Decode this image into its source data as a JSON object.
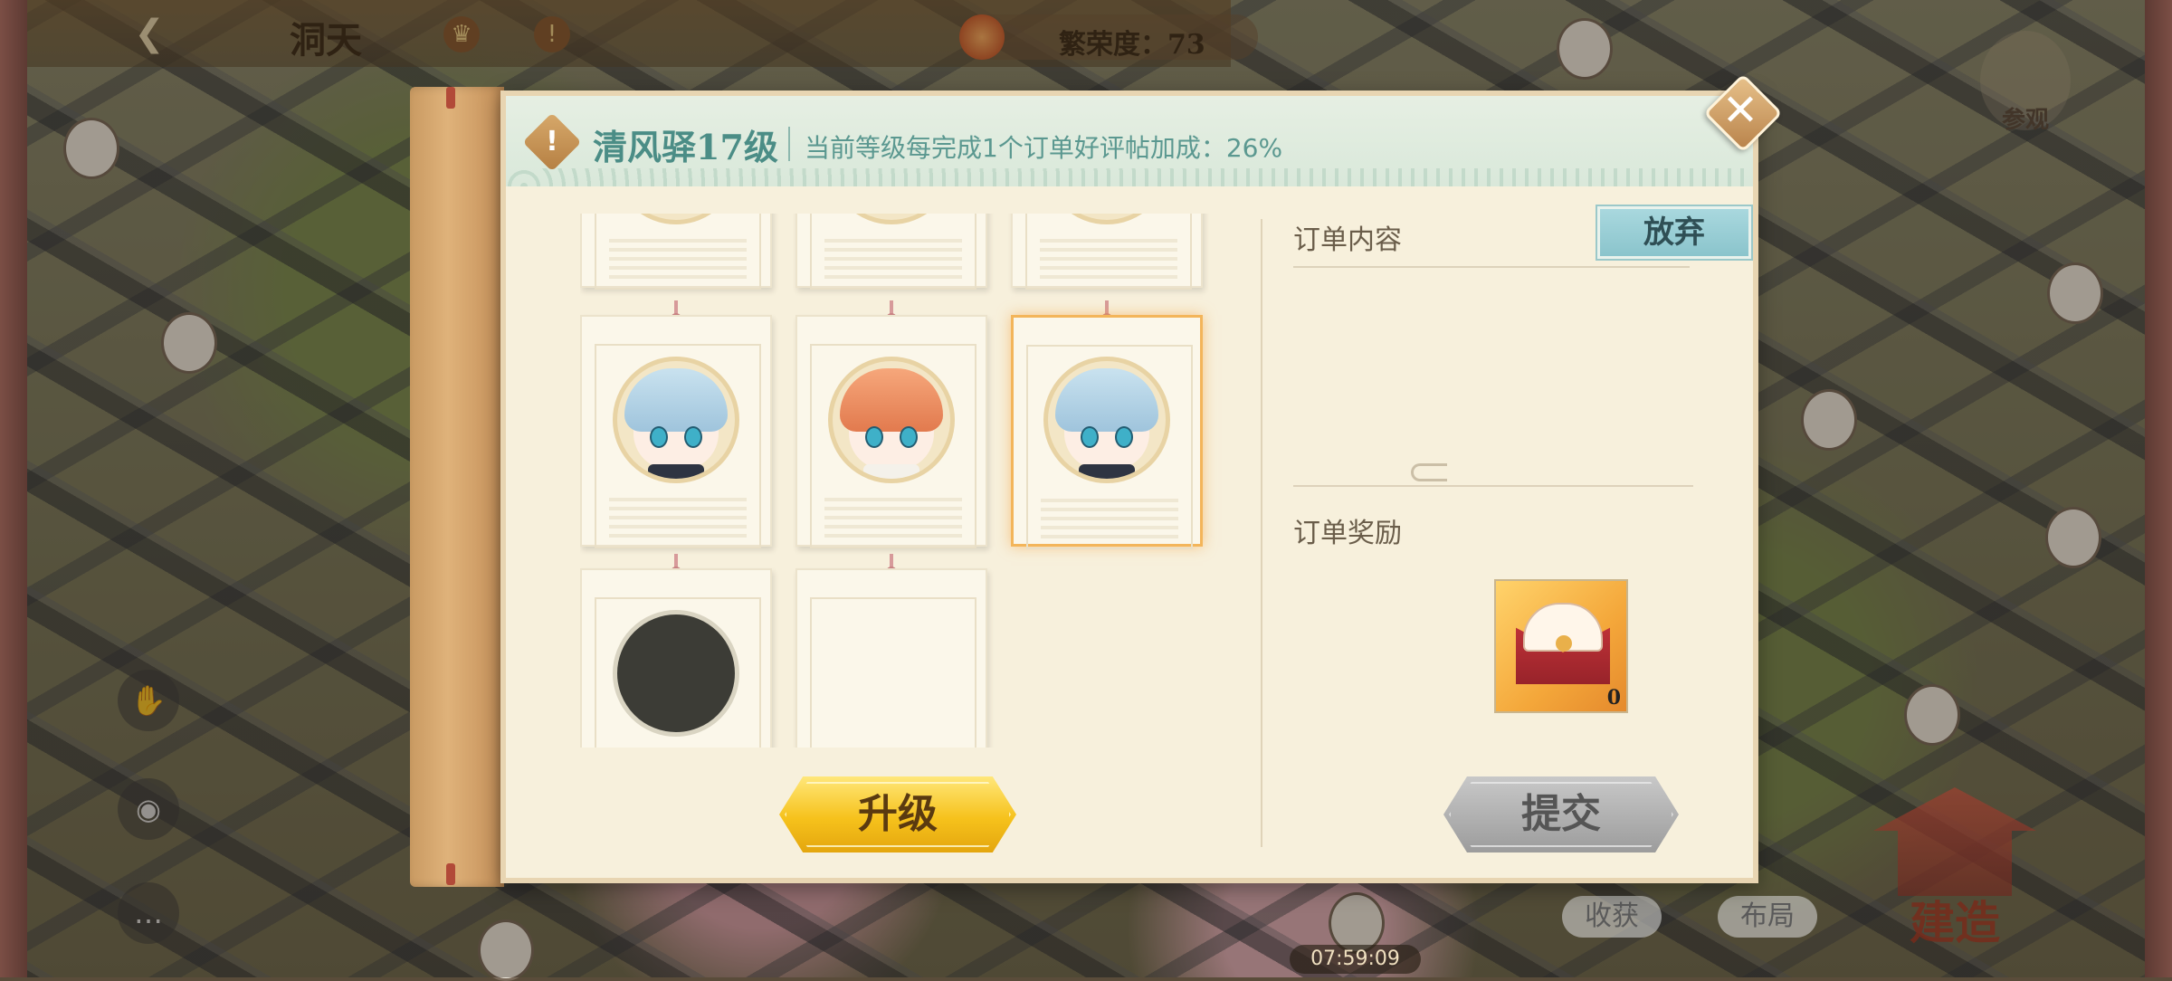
{
  "hud": {
    "title": "洞天",
    "prosperity": "繁荣度：73",
    "visit_label": "参观",
    "harvest_label": "收获",
    "layout_label": "布局",
    "build_label": "建造",
    "timer": "07:59:09"
  },
  "dialog": {
    "level_title": "清风驿17级",
    "description": "当前等级每完成1个订单好评帖加成：26%",
    "order_content_label": "订单内容",
    "abandon_label": "放弃",
    "reward_label": "订单奖励",
    "reward_count": "0",
    "upgrade_label": "升级",
    "submit_label": "提交"
  },
  "colors": {
    "accent_teal": "#4b8d86",
    "upgrade_gold": "#f6c21c",
    "abandon_blue": "#8ac4cc",
    "selected_border": "#f3b55a"
  }
}
